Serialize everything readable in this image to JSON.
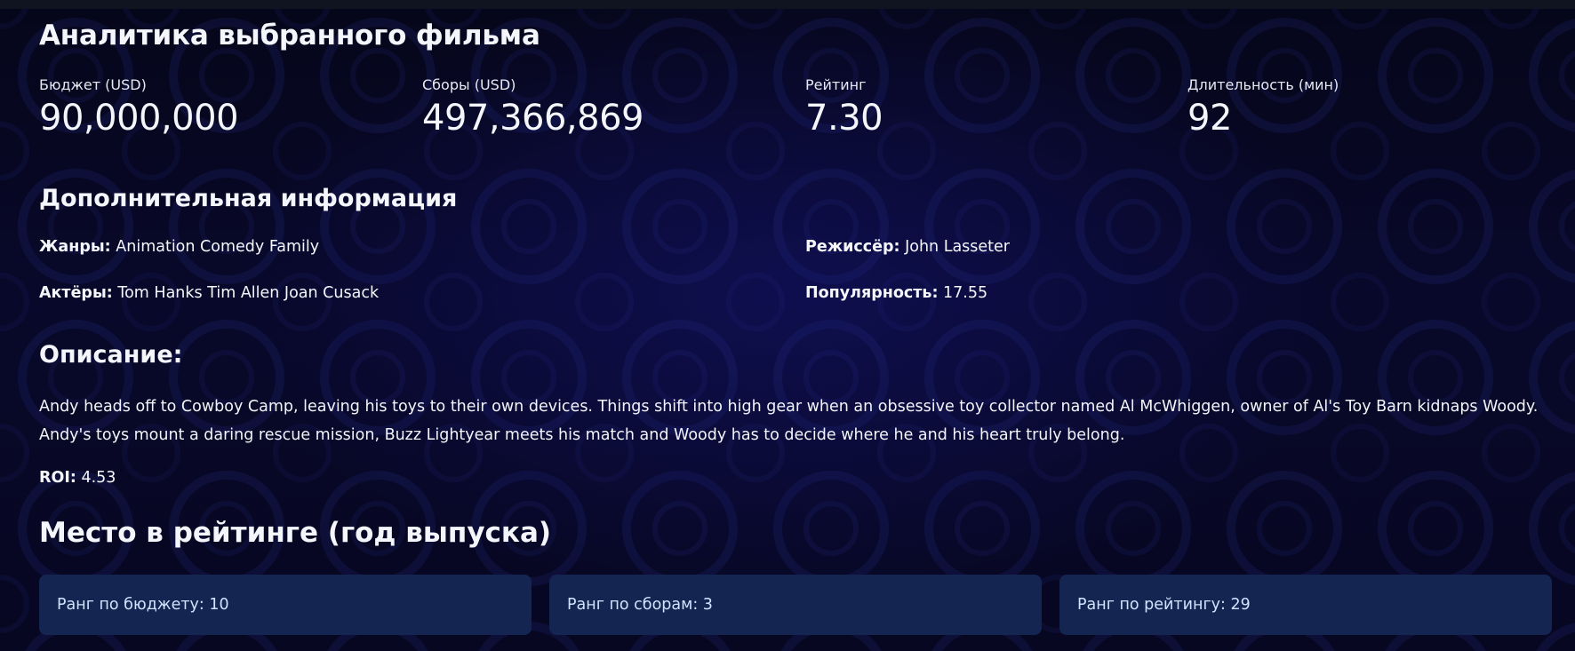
{
  "page": {
    "title": "Аналитика выбранного фильма"
  },
  "metrics": [
    {
      "label": "Бюджет (USD)",
      "value": "90,000,000"
    },
    {
      "label": "Сборы (USD)",
      "value": "497,366,869"
    },
    {
      "label": "Рейтинг",
      "value": "7.30"
    },
    {
      "label": "Длительность (мин)",
      "value": "92"
    }
  ],
  "details": {
    "heading": "Дополнительная информация",
    "genres_label": "Жанры:",
    "genres_value": "Animation Comedy Family",
    "director_label": "Режиссёр:",
    "director_value": "John Lasseter",
    "actors_label": "Актёры:",
    "actors_value": "Tom Hanks Tim Allen Joan Cusack",
    "popularity_label": "Популярность:",
    "popularity_value": "17.55"
  },
  "description": {
    "heading": "Описание:",
    "text": "Andy heads off to Cowboy Camp, leaving his toys to their own devices. Things shift into high gear when an obsessive toy collector named Al McWhiggen, owner of Al's Toy Barn kidnaps Woody. Andy's toys mount a daring rescue mission, Buzz Lightyear meets his match and Woody has to decide where he and his heart truly belong."
  },
  "roi": {
    "label": "ROI:",
    "value": "4.53"
  },
  "ranking": {
    "heading": "Место в рейтинге (год выпуска)",
    "cards": [
      {
        "text": "Ранг по бюджету: 10"
      },
      {
        "text": "Ранг по сборам: 3"
      },
      {
        "text": "Ранг по рейтингу: 29"
      }
    ]
  },
  "colors": {
    "background": "#07071a",
    "card": "#132550",
    "card_text": "#cfe4ff",
    "text": "#f4f6fb"
  }
}
